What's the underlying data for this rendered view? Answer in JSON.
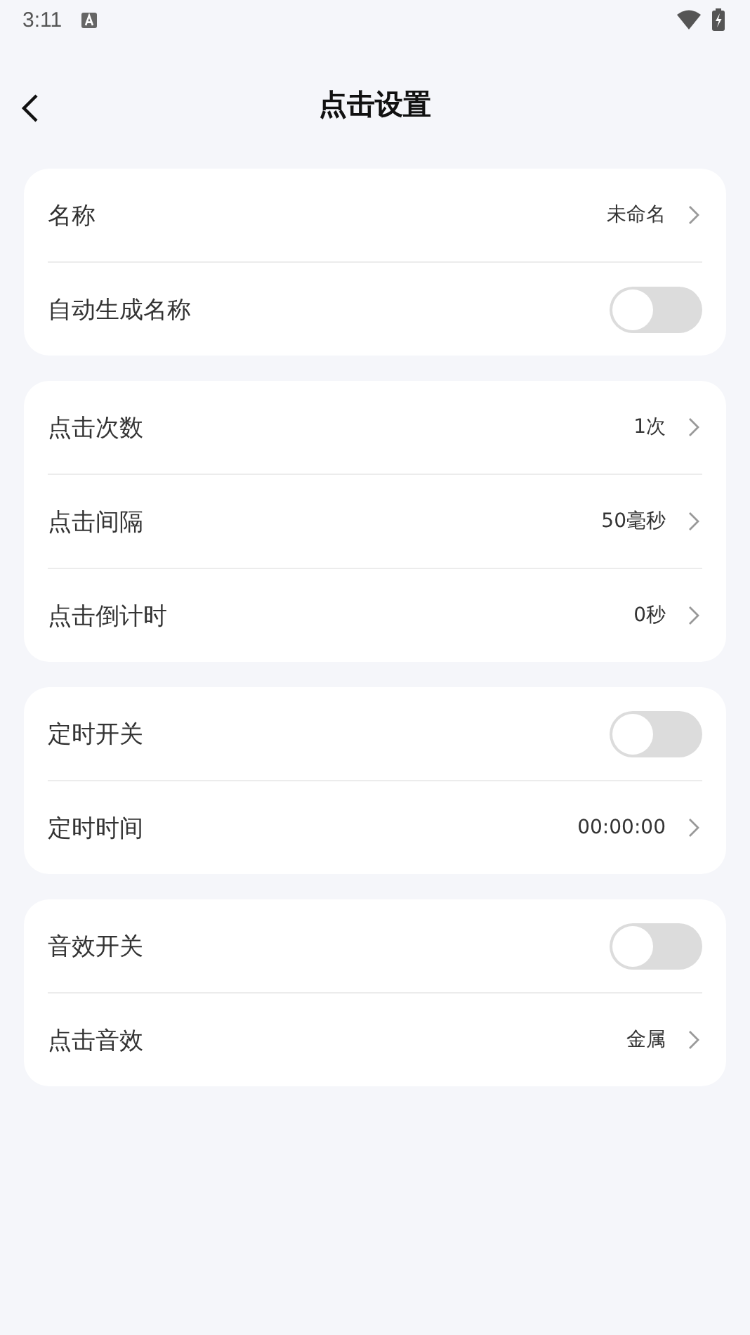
{
  "status_bar": {
    "time": "3:11"
  },
  "header": {
    "title": "点击设置"
  },
  "groups": [
    {
      "rows": [
        {
          "kind": "value",
          "label": "名称",
          "value": "未命名"
        },
        {
          "kind": "switch",
          "label": "自动生成名称",
          "on": false
        }
      ]
    },
    {
      "rows": [
        {
          "kind": "value",
          "label": "点击次数",
          "value": "1次"
        },
        {
          "kind": "value",
          "label": "点击间隔",
          "value": "50毫秒"
        },
        {
          "kind": "value",
          "label": "点击倒计时",
          "value": "0秒"
        }
      ]
    },
    {
      "rows": [
        {
          "kind": "switch",
          "label": "定时开关",
          "on": false
        },
        {
          "kind": "value",
          "label": "定时时间",
          "value": "00:00:00"
        }
      ]
    },
    {
      "rows": [
        {
          "kind": "switch",
          "label": "音效开关",
          "on": false
        },
        {
          "kind": "value",
          "label": "点击音效",
          "value": "金属"
        }
      ]
    }
  ]
}
